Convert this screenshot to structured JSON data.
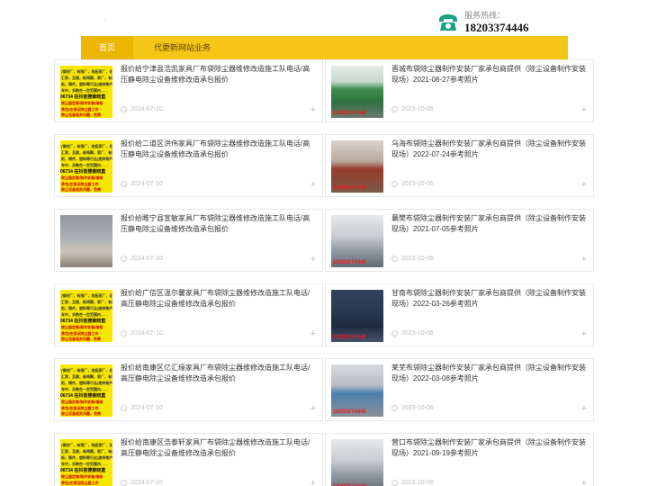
{
  "header": {
    "logo_text": ".",
    "hotline_label": "服务热线：",
    "hotline_number": "18203374446",
    "phone_color": "#17a086"
  },
  "nav": {
    "items": [
      {
        "label": "首页",
        "active": true
      },
      {
        "label": "代更新网站业务",
        "active": false
      }
    ],
    "bar_color": "#f5c518"
  },
  "left_cards": [
    {
      "title": "报价给宁津县浩凯家具厂布袋除尘器维修改造施工队电话/高压静电除尘设备维修改造承包报价",
      "date": "2024-07-10",
      "thumb": "yellow"
    },
    {
      "title": "报价给二道区洪伟家具厂布袋除尘器维修改造施工队电话/高压静电除尘设备维修改造承包报价",
      "date": "2024-07-10",
      "thumb": "yellow"
    },
    {
      "title": "报价给睢宁县宣敏家具厂布袋除尘器维修改造施工队电话/高压静电除尘设备维修改造承包报价",
      "date": "2024-07-10",
      "thumb": "floor"
    },
    {
      "title": "报价给广信区温尔馨家具厂布袋除尘器维修改造施工队电话/高压静电除尘设备维修改造承包报价",
      "date": "2024-07-10",
      "thumb": "yellow"
    },
    {
      "title": "报价给南康区亿汇缘家具厂布袋除尘器维修改造施工队电话/高压静电除尘设备维修改造承包报价",
      "date": "2024-07-10",
      "thumb": "yellow"
    },
    {
      "title": "报价给南康区浩泰轩家具厂布袋除尘器维修改造施工队电话/高压静电除尘设备维修改造承包报价",
      "date": "2024-07-10",
      "thumb": "yellow"
    }
  ],
  "right_cards": [
    {
      "title": "晋城布袋除尘器制作安装厂家承包商提供（除尘设备制作安装现场）2021-08-27参考照片",
      "date": "2023-10-06",
      "thumb": "green",
      "stamp": "18203374446"
    },
    {
      "title": "乌海布袋除尘器制作安装厂家承包商提供（除尘设备制作安装现场）2022-07-24参考照片",
      "date": "2023-10-06",
      "thumb": "red",
      "stamp": "18203374446"
    },
    {
      "title": "襄樊布袋除尘器制作安装厂家承包商提供（除尘设备制作安装现场）2021-07-05参考照片",
      "date": "2023-10-06",
      "thumb": "gray",
      "stamp": "18203374446"
    },
    {
      "title": "甘南布袋除尘器制作安装厂家承包商提供（除尘设备制作安装现场）2022-03-26参考照片",
      "date": "2023-10-06",
      "thumb": "blue",
      "stamp": "18203374446"
    },
    {
      "title": "莱芜布袋除尘器制作安装厂家承包商提供（除尘设备制作安装现场）2022-03-08参考照片",
      "date": "2023-10-06",
      "thumb": "room",
      "stamp": "18203374446"
    },
    {
      "title": "营口布袋除尘器制作安装厂家承包商提供（除尘设备制作安装现场）2021-09-19参考照片",
      "date": "2023-10-06",
      "thumb": "gray",
      "stamp": "18203374446"
    }
  ],
  "yellow_thumb_lines": [
    "(钢材厂，有限厂，地板家厂，化",
    "汇家，瓦楼，新鸡颗，家厂，有限",
    "柜，铸件，塑料等行业)废弃物产",
    "车中，多数在一定范围内……"
  ],
  "yellow_thumb_phone": "06734  在抖音搜索晓直",
  "yellow_thumb_red_lines": [
    "除尘器定做/制作安装/维修",
    "承包(在保证除尘器工作",
    "除尘设备相关问题，免费"
  ],
  "card_plus": "+"
}
